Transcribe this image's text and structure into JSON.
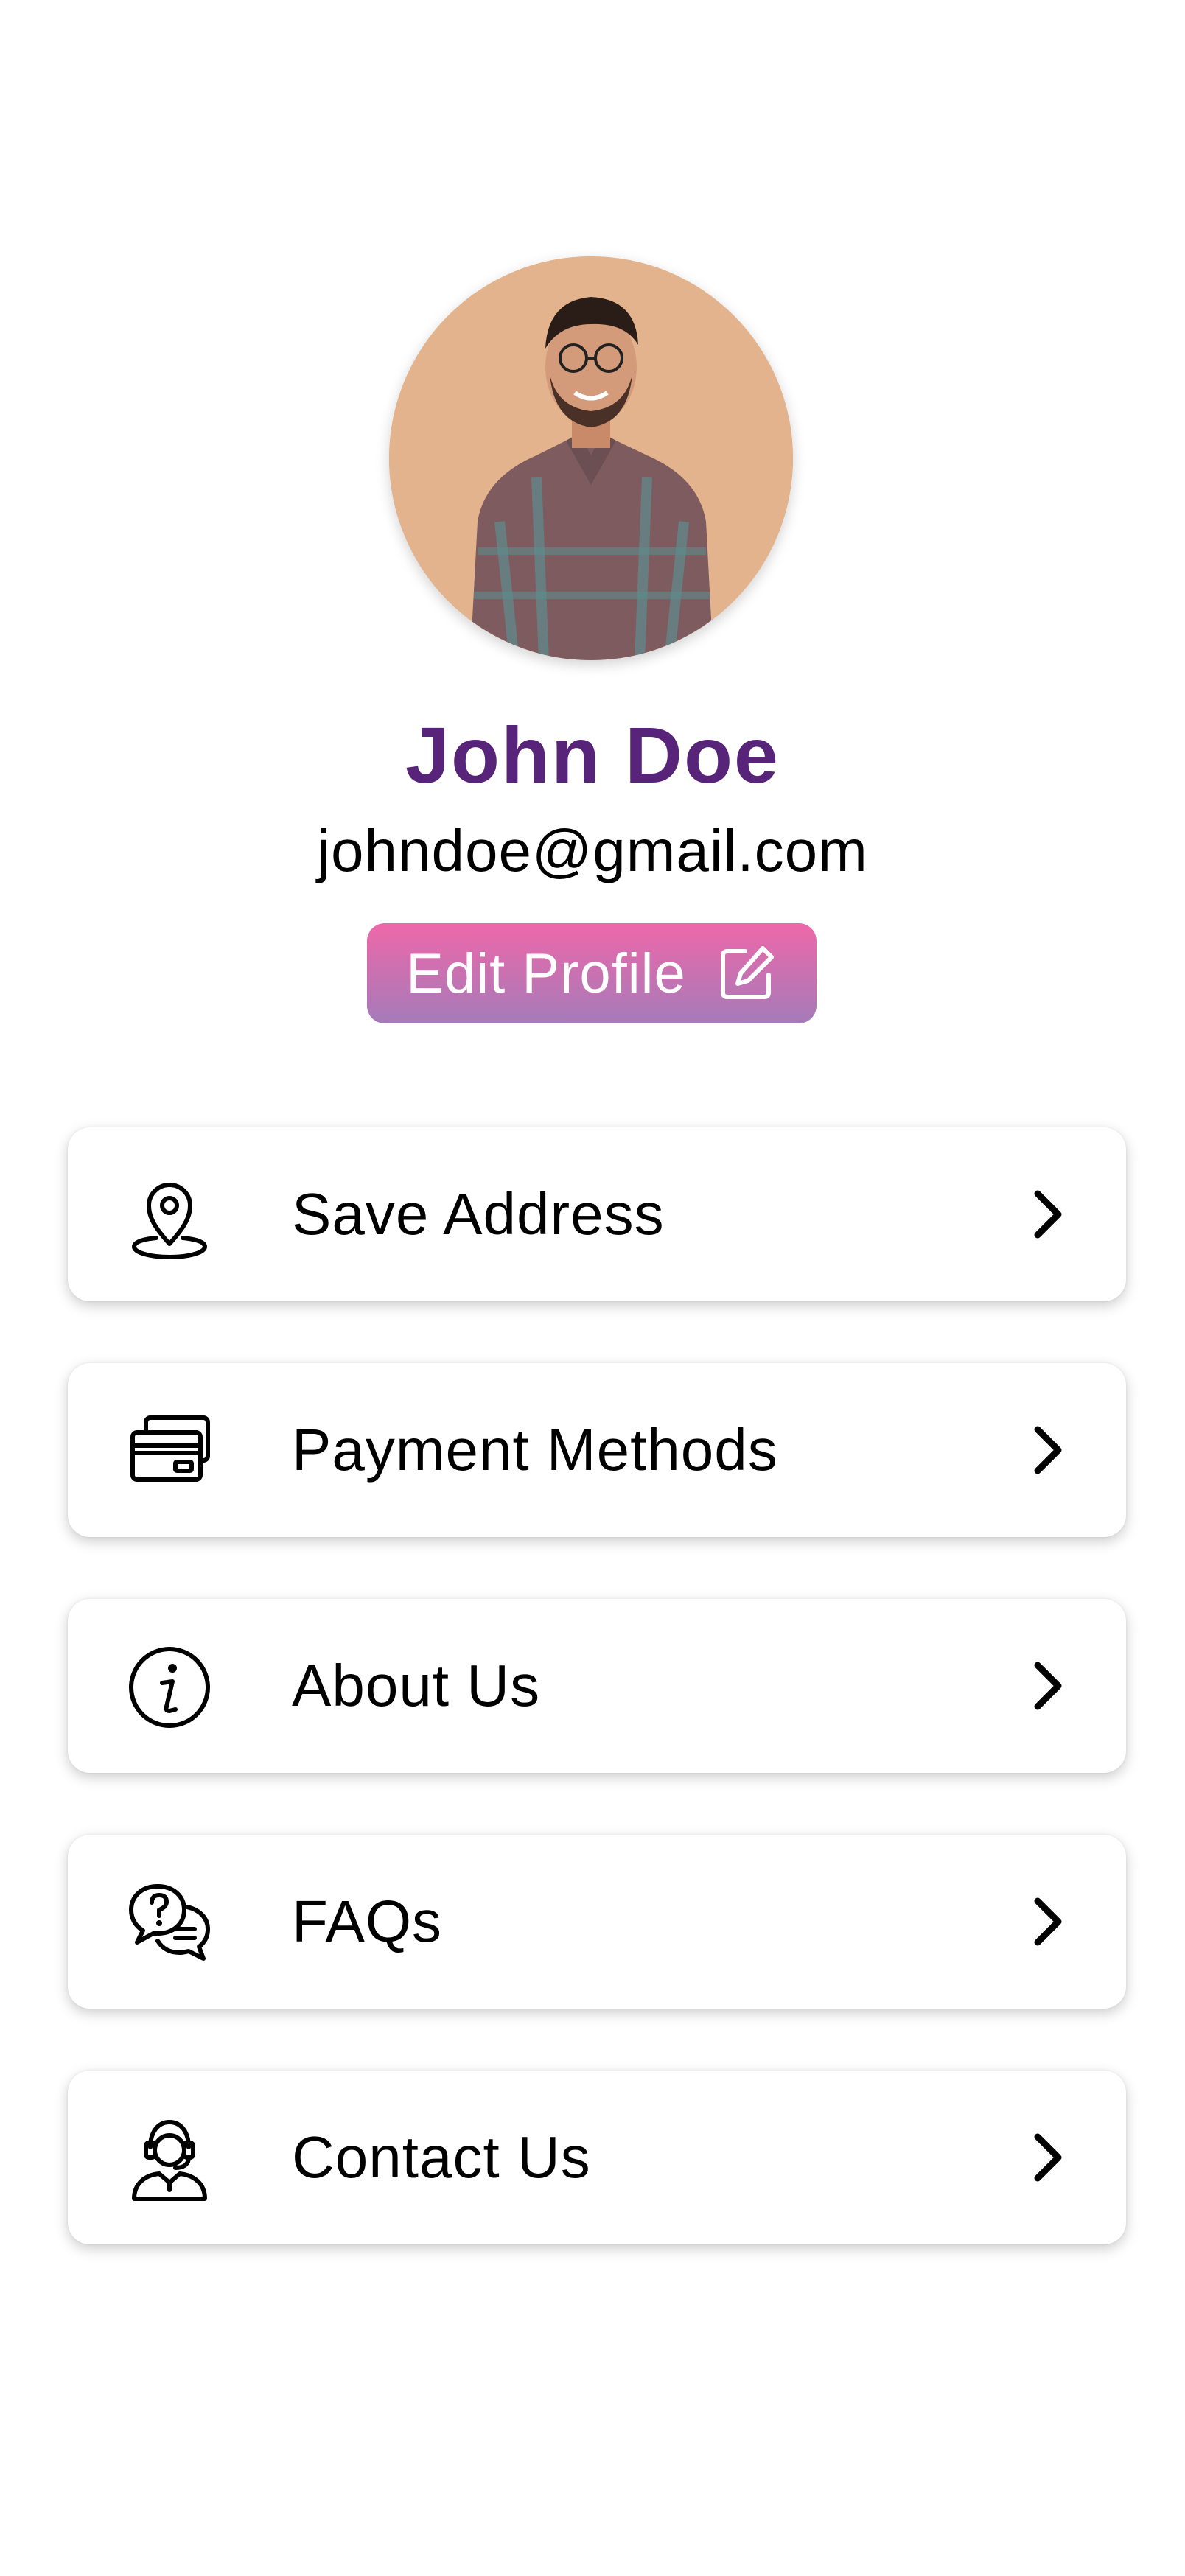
{
  "profile": {
    "name": "John Doe",
    "email": "johndoe@gmail.com",
    "avatar_icon": "profile-photo",
    "edit_button_label": "Edit Profile",
    "edit_icon": "edit-icon"
  },
  "colors": {
    "name": "#572479",
    "button_gradient_top": "#ee68a9",
    "button_gradient_bottom": "#a57bb9"
  },
  "menu": {
    "items": [
      {
        "label": "Save Address",
        "icon": "location-pin-icon"
      },
      {
        "label": "Payment Methods",
        "icon": "credit-card-icon"
      },
      {
        "label": "About Us",
        "icon": "info-icon"
      },
      {
        "label": "FAQs",
        "icon": "faq-chat-icon"
      },
      {
        "label": "Contact Us",
        "icon": "support-agent-icon"
      }
    ],
    "chevron_icon": "chevron-right-icon"
  }
}
